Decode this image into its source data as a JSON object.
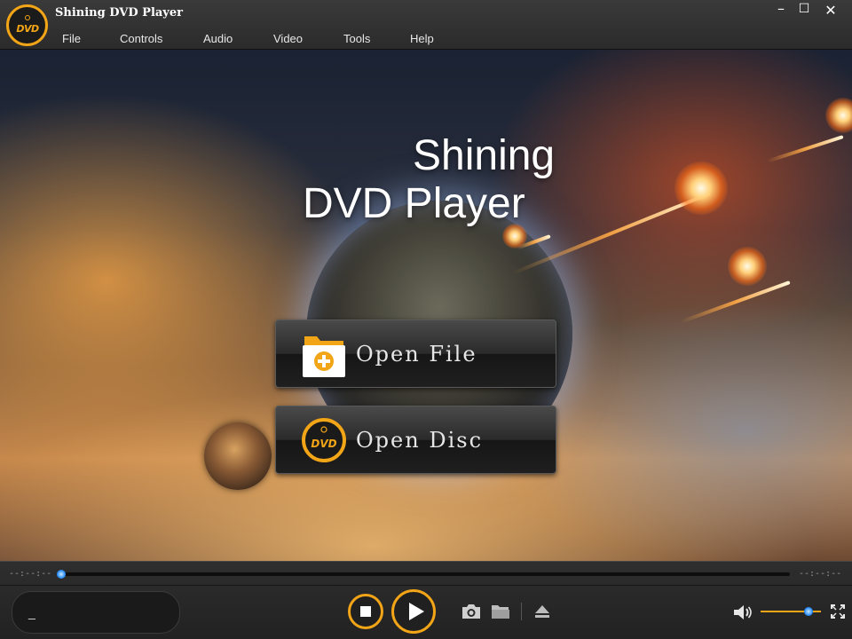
{
  "app": {
    "title": "Shining DVD Player",
    "logo_text": "DVD"
  },
  "menu": [
    {
      "label": "File"
    },
    {
      "label": "Controls"
    },
    {
      "label": "Audio"
    },
    {
      "label": "Video"
    },
    {
      "label": "Tools"
    },
    {
      "label": "Help"
    }
  ],
  "window_controls": {
    "minimize": "–",
    "maximize": "☐",
    "close": "✕"
  },
  "brand": {
    "line1": "Shining",
    "line2": "DVD Player"
  },
  "actions": {
    "open_file": "Open File",
    "open_disc": "Open Disc",
    "disc_icon_text": "DVD"
  },
  "playback": {
    "time_elapsed": "--:--:--",
    "time_total": "--:--:--",
    "progress": 0,
    "info_text": "_",
    "volume": 0.8
  },
  "colors": {
    "accent": "#f2a516",
    "knob": "#2b8fff"
  }
}
